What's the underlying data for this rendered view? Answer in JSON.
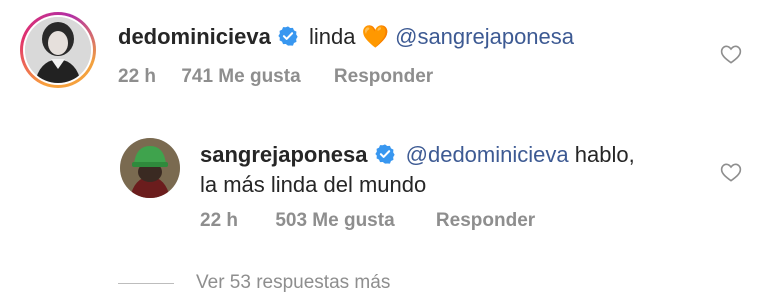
{
  "comments": [
    {
      "username": "dedominicieva",
      "text_before": "linda",
      "emoji": "🧡",
      "mention": "@sangrejaponesa",
      "text_after": "",
      "time": "22 h",
      "likes": "741 Me gusta",
      "reply_label": "Responder"
    },
    {
      "username": "sangrejaponesa",
      "mention": "@dedominicieva",
      "text_line1": "hablo,",
      "text_line2": "la más linda del mundo",
      "time": "22 h",
      "likes": "503 Me gusta",
      "reply_label": "Responder"
    }
  ],
  "view_more": "Ver 53 respuestas más",
  "colors": {
    "text": "#262626",
    "meta": "#8e8e8e",
    "mention": "#3d5a93",
    "verified": "#3897f0"
  },
  "icons": {
    "verified": "verified-badge-icon",
    "like": "heart-outline-icon"
  }
}
